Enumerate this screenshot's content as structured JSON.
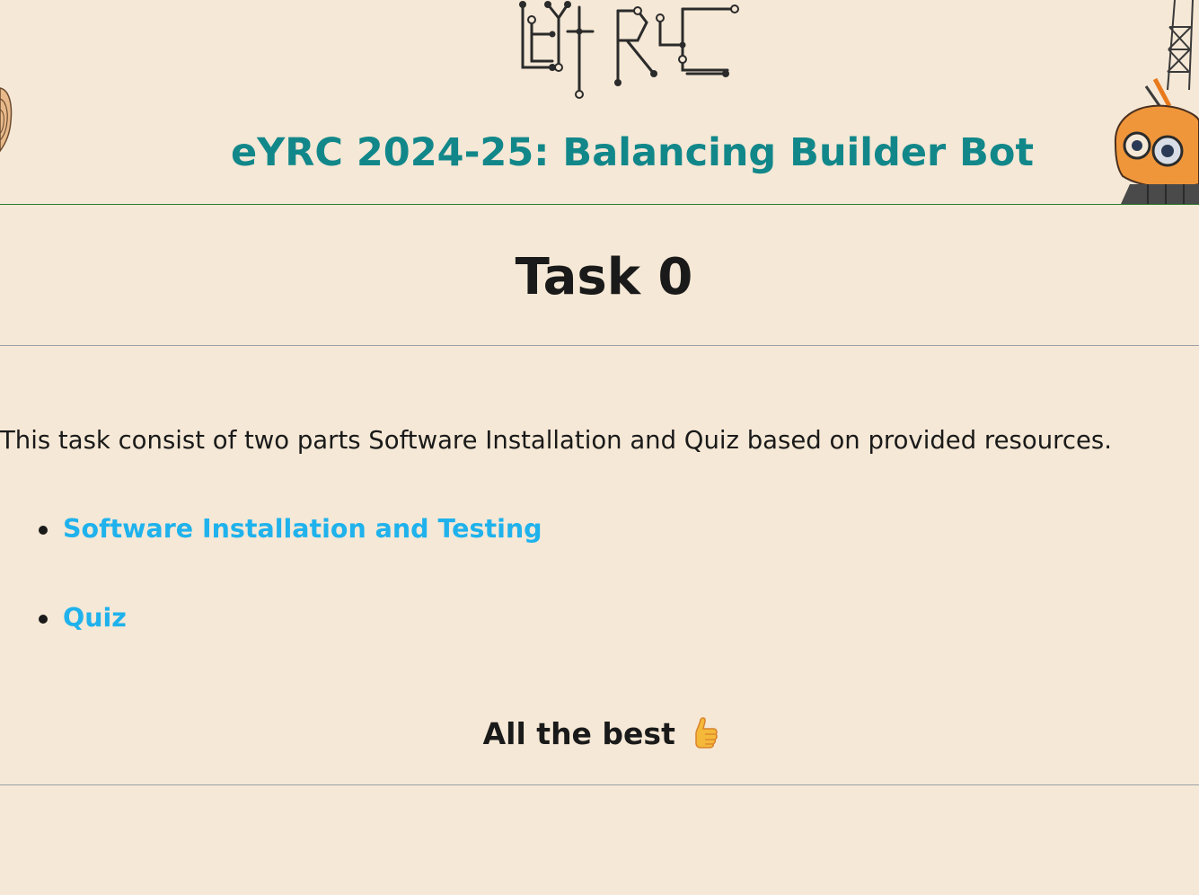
{
  "header": {
    "logo_text": "eYRC",
    "site_title": "eYRC 2024-25: Balancing Builder Bot"
  },
  "main": {
    "task_title": "Task 0",
    "intro": "This task consist of two parts Software Installation and Quiz based on provided resources.",
    "links": [
      {
        "label": "Software Installation and Testing"
      },
      {
        "label": "Quiz"
      }
    ],
    "closing": "All the best",
    "closing_icon": "thumbs-up-icon"
  },
  "colors": {
    "background": "#f5e8d6",
    "title": "#12878a",
    "link": "#1fb2ec",
    "header_rule": "#2e7d32",
    "divider": "#9aa0a6"
  }
}
